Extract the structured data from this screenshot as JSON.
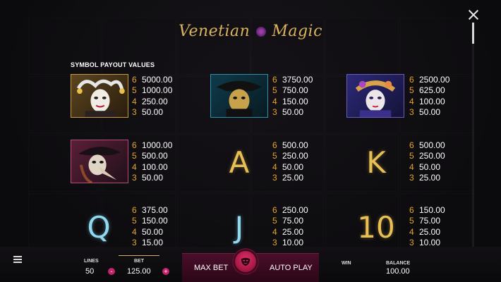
{
  "header": {
    "logo_part1": "Venetian",
    "logo_part2": "Magic"
  },
  "section": {
    "title": "SYMBOL PAYOUT VALUES"
  },
  "symbols": [
    {
      "name": "jester-mask",
      "icon": "jester-mask-icon",
      "payouts": [
        {
          "count": "6",
          "value": "5000.00"
        },
        {
          "count": "5",
          "value": "1000.00"
        },
        {
          "count": "4",
          "value": "250.00"
        },
        {
          "count": "3",
          "value": "50.00"
        }
      ]
    },
    {
      "name": "tricorn-mask",
      "icon": "tricorn-mask-icon",
      "payouts": [
        {
          "count": "6",
          "value": "3750.00"
        },
        {
          "count": "5",
          "value": "750.00"
        },
        {
          "count": "4",
          "value": "150.00"
        },
        {
          "count": "3",
          "value": "50.00"
        }
      ]
    },
    {
      "name": "lady-mask",
      "icon": "lady-mask-icon",
      "payouts": [
        {
          "count": "6",
          "value": "2500.00"
        },
        {
          "count": "5",
          "value": "625.00"
        },
        {
          "count": "4",
          "value": "100.00"
        },
        {
          "count": "3",
          "value": "50.00"
        }
      ]
    },
    {
      "name": "plague-doctor-mask",
      "icon": "plague-doctor-mask-icon",
      "payouts": [
        {
          "count": "6",
          "value": "1000.00"
        },
        {
          "count": "5",
          "value": "500.00"
        },
        {
          "count": "4",
          "value": "100.00"
        },
        {
          "count": "3",
          "value": "50.00"
        }
      ]
    },
    {
      "name": "A",
      "letter": "A",
      "payouts": [
        {
          "count": "6",
          "value": "500.00"
        },
        {
          "count": "5",
          "value": "250.00"
        },
        {
          "count": "4",
          "value": "50.00"
        },
        {
          "count": "3",
          "value": "25.00"
        }
      ]
    },
    {
      "name": "K",
      "letter": "K",
      "payouts": [
        {
          "count": "6",
          "value": "500.00"
        },
        {
          "count": "5",
          "value": "250.00"
        },
        {
          "count": "4",
          "value": "50.00"
        },
        {
          "count": "3",
          "value": "25.00"
        }
      ]
    },
    {
      "name": "Q",
      "letter": "Q",
      "payouts": [
        {
          "count": "6",
          "value": "375.00"
        },
        {
          "count": "5",
          "value": "150.00"
        },
        {
          "count": "4",
          "value": "50.00"
        },
        {
          "count": "3",
          "value": "15.00"
        }
      ]
    },
    {
      "name": "J",
      "letter": "J",
      "payouts": [
        {
          "count": "6",
          "value": "250.00"
        },
        {
          "count": "5",
          "value": "75.00"
        },
        {
          "count": "4",
          "value": "25.00"
        },
        {
          "count": "3",
          "value": "10.00"
        }
      ]
    },
    {
      "name": "10",
      "letter": "10",
      "payouts": [
        {
          "count": "6",
          "value": "150.00"
        },
        {
          "count": "5",
          "value": "75.00"
        },
        {
          "count": "4",
          "value": "25.00"
        },
        {
          "count": "3",
          "value": "10.00"
        }
      ]
    }
  ],
  "bottombar": {
    "lines_label": "LINES",
    "lines_value": "50",
    "bet_label": "BET",
    "bet_value": "125.00",
    "minus_label": "-",
    "plus_label": "+",
    "max_bet_label": "MAX BET",
    "auto_play_label": "AUTO PLAY",
    "win_label": "WIN",
    "balance_label": "BALANCE",
    "balance_value": "100.00"
  },
  "colors": {
    "gold_letters": "#e7bf55",
    "blue_letters": "#8fd8ef",
    "count_orange": "#e4a72c",
    "action_panel": "#4a0e2a",
    "spin_button": "#c8245a"
  }
}
